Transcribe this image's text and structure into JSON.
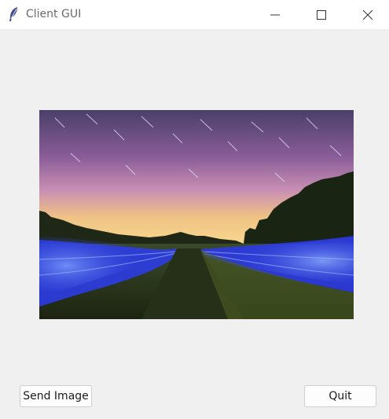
{
  "window": {
    "title": "Client GUI",
    "icon": "feather-icon",
    "controls": [
      "minimize-icon",
      "maximize-icon",
      "close-icon"
    ]
  },
  "image": {
    "description": "night sky star trails over field with blue light painting"
  },
  "buttons": {
    "send_label": "Send Image",
    "quit_label": "Quit"
  },
  "colors": {
    "background": "#f0f0f0",
    "titlebar": "#ffffff",
    "title_text": "#6b6b6b"
  }
}
